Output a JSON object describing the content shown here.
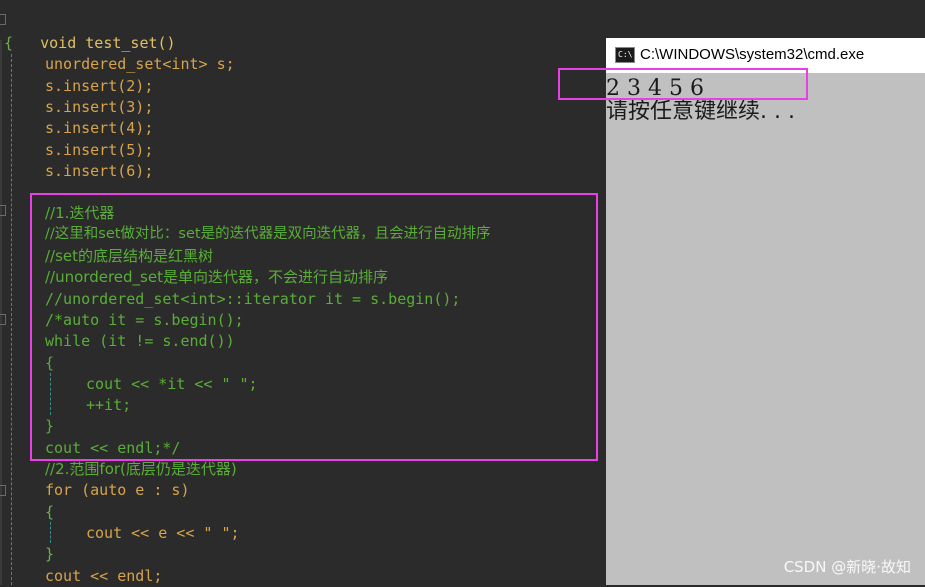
{
  "code_lines": [
    "void test_set()",
    "{",
    "unordered_set<int> s;",
    "s.insert(2);",
    "s.insert(3);",
    "s.insert(4);",
    "s.insert(5);",
    "s.insert(6);",
    "",
    "//1.迭代器",
    "//这里和set做对比：set是的迭代器是双向迭代器，且会进行自动排序",
    "//set的底层结构是红黑树",
    "//unordered_set是单向迭代器，不会进行自动排序",
    "//unordered_set<int>::iterator it = s.begin();",
    "/*auto it = s.begin();",
    "while (it != s.end())",
    "{",
    "cout << *it << \" \";",
    "++it;",
    "}",
    "cout << endl;*/",
    "//2.范围for(底层仍是迭代器)",
    "for (auto e : s)",
    "{",
    "cout << e << \" \";",
    "}",
    "cout << endl;"
  ],
  "console": {
    "title": "C:\\WINDOWS\\system32\\cmd.exe",
    "icon": "cmd-icon",
    "icon_text": "C:\\",
    "output_lines": [
      "2 3 4 5 6",
      "请按任意键继续. . ."
    ]
  },
  "watermark": "CSDN @新晓·故知",
  "colors": {
    "highlight_box": "#ea3ee6",
    "comment": "#5aae38",
    "keyword": "#d7a44a",
    "background": "#2b2b2b",
    "console_bg": "#c0c0c0"
  }
}
